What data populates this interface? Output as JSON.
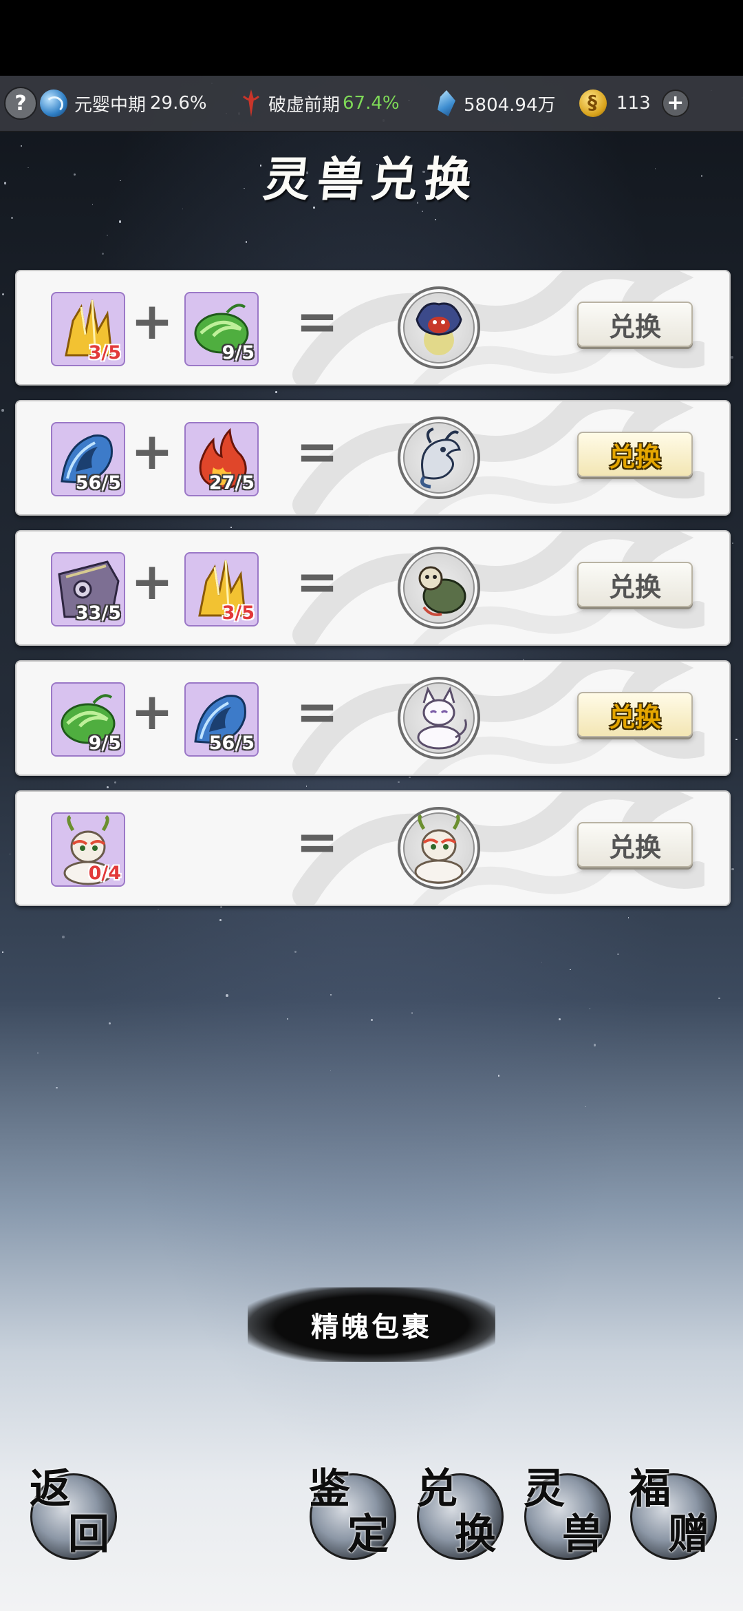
{
  "status_bar": {
    "cultivation_stage": "元婴中期",
    "cultivation_pct": "29.6%",
    "breakthrough_stage": "破虚前期",
    "breakthrough_pct": "67.4%",
    "spirit_stones": "5804.94万",
    "gold": "113",
    "icons": [
      "help-icon",
      "yin-yang-icon",
      "spear-icon",
      "spirit-stone-icon",
      "gold-coin-icon",
      "add-icon"
    ]
  },
  "title": "灵兽兑换",
  "recipes": [
    {
      "ing1": {
        "icon": "yellow-crystal-icon",
        "count": "3/5",
        "insufficient": true
      },
      "ing2": {
        "icon": "green-swirl-icon",
        "count": "9/5",
        "insufficient": false
      },
      "beast": "demon-beast-icon",
      "button": "兑换",
      "active": false
    },
    {
      "ing1": {
        "icon": "blue-wave-icon",
        "count": "56/5",
        "insufficient": false
      },
      "ing2": {
        "icon": "flame-icon",
        "count": "27/5",
        "insufficient": false
      },
      "beast": "sea-dragon-icon",
      "button": "兑换",
      "active": true
    },
    {
      "ing1": {
        "icon": "purple-shell-icon",
        "count": "33/5",
        "insufficient": false
      },
      "ing2": {
        "icon": "yellow-crystal-icon",
        "count": "3/5",
        "insufficient": true
      },
      "beast": "turtle-beast-icon",
      "button": "兑换",
      "active": false
    },
    {
      "ing1": {
        "icon": "green-swirl-icon",
        "count": "9/5",
        "insufficient": false
      },
      "ing2": {
        "icon": "blue-wave-icon",
        "count": "56/5",
        "insufficient": false
      },
      "beast": "white-fox-icon",
      "button": "兑换",
      "active": true
    },
    {
      "ing1": {
        "icon": "deer-beast-icon",
        "count": "0/4",
        "insufficient": true
      },
      "ing2": null,
      "beast": "deer-beast-icon",
      "button": "兑换",
      "active": false
    }
  ],
  "bundle_button": "精魄包裹",
  "nav": {
    "back": [
      "返",
      "回"
    ],
    "appraise": [
      "鉴",
      "定"
    ],
    "exchange": [
      "兑",
      "换"
    ],
    "beast": [
      "灵",
      "兽"
    ],
    "gift": [
      "福",
      "赠"
    ]
  }
}
